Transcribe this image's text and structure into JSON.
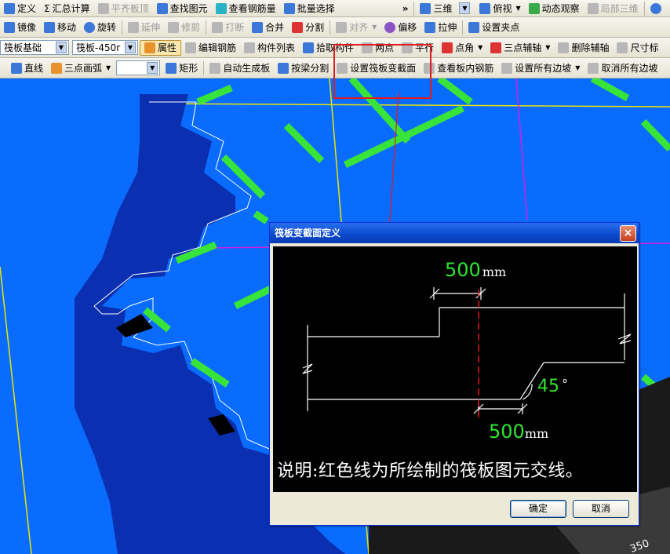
{
  "toolbar1": {
    "define": "定义",
    "sum_calc": "汇总计算",
    "flat_board_top": "平齐板顶",
    "find_element": "查找图元",
    "view_rebar": "查看钢筋量",
    "batch_select": "批量选择",
    "more": "»",
    "view_3d": "三维",
    "top_view": "俯视",
    "dynamic_observe": "动态观察",
    "local_3d": "局部三维"
  },
  "toolbar2": {
    "mirror": "镜像",
    "move": "移动",
    "rotate": "旋转",
    "extend": "延伸",
    "trim": "修剪",
    "break": "打断",
    "merge": "合并",
    "split": "分割",
    "align": "对齐",
    "offset": "偏移",
    "stretch": "拉伸",
    "set_grip": "设置夹点"
  },
  "toolbar3": {
    "category_value": "筏板基础",
    "member_value": "筏板-450r",
    "properties": "属性",
    "edit_rebar": "编辑钢筋",
    "member_list": "构件列表",
    "pick_member": "拾取构件",
    "two_points": "两点",
    "parallel": "平行",
    "point_angle": "点角",
    "three_point_axis": "三点辅轴",
    "delete_axis": "删除辅轴",
    "dimension": "尺寸标"
  },
  "toolbar4": {
    "line": "直线",
    "three_point_arc": "三点画弧",
    "rectangle": "矩形",
    "auto_generate": "自动生成板",
    "split_by_beam": "按梁分割",
    "set_variable_section": "设置筏板变截面",
    "view_slab_rebar": "查看板内钢筋",
    "set_all_slopes": "设置所有边坡",
    "cancel_all_slopes": "取消所有边坡"
  },
  "dialog": {
    "title": "筏板变截面定义",
    "close": "×",
    "dim_top_value": "500",
    "dim_top_unit": "mm",
    "dim_bottom_value": "500",
    "dim_bottom_unit": "mm",
    "angle_value": "45",
    "angle_unit": "°",
    "note": "说明:红色线为所绘制的筏板图元交线。",
    "ok": "确定",
    "cancel": "取消"
  },
  "canvas_label": "350",
  "colors": {
    "background_blue": "#0a6cff",
    "slab_dark_blue": "#0a2fb0",
    "green_beam": "#39e43a",
    "magenta_axis": "#d21ee0",
    "yellow_axis": "#e9e500",
    "highlight_red": "#e01b1b",
    "dim_green": "#2ee62e"
  }
}
